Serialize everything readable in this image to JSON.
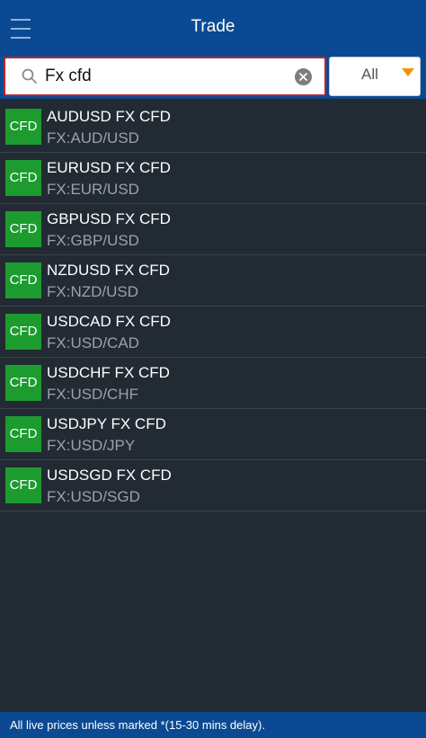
{
  "header": {
    "title": "Trade",
    "menu_icon": "hamburger-menu-icon"
  },
  "search": {
    "value": "Fx cfd",
    "search_icon": "magnifier-icon",
    "clear_icon": "clear-circle-x-icon"
  },
  "filter": {
    "selected": "All",
    "arrow_color": "#f39200"
  },
  "colors": {
    "header_bg": "#0b4a93",
    "list_bg": "#222a33",
    "badge_bg": "#1c9b2f",
    "search_border": "#c0232b"
  },
  "instruments": [
    {
      "badge": "CFD",
      "name": "AUDUSD FX CFD",
      "symbol": "FX:AUD/USD"
    },
    {
      "badge": "CFD",
      "name": "EURUSD FX CFD",
      "symbol": "FX:EUR/USD"
    },
    {
      "badge": "CFD",
      "name": "GBPUSD FX CFD",
      "symbol": "FX:GBP/USD"
    },
    {
      "badge": "CFD",
      "name": "NZDUSD FX CFD",
      "symbol": "FX:NZD/USD"
    },
    {
      "badge": "CFD",
      "name": "USDCAD FX CFD",
      "symbol": "FX:USD/CAD"
    },
    {
      "badge": "CFD",
      "name": "USDCHF FX CFD",
      "symbol": "FX:USD/CHF"
    },
    {
      "badge": "CFD",
      "name": "USDJPY FX CFD",
      "symbol": "FX:USD/JPY"
    },
    {
      "badge": "CFD",
      "name": "USDSGD FX CFD",
      "symbol": "FX:USD/SGD"
    }
  ],
  "footer": {
    "note": "All live prices unless marked *(15-30 mins delay)."
  }
}
